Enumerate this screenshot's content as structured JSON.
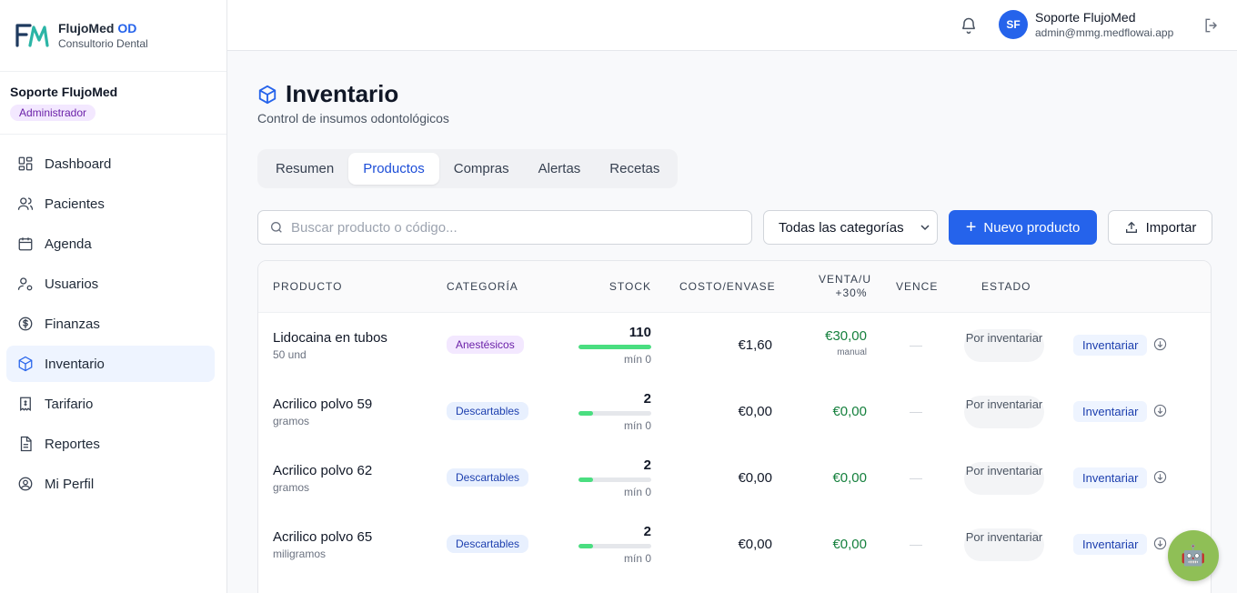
{
  "brand": {
    "name": "FlujoMed",
    "accent": "OD",
    "subtitle": "Consultorio Dental"
  },
  "user": {
    "name": "Soporte FlujoMed",
    "role": "Administrador",
    "initials": "SF",
    "email": "admin@mmg.medflowai.app"
  },
  "nav": [
    {
      "label": "Dashboard",
      "icon": "dashboard-icon"
    },
    {
      "label": "Pacientes",
      "icon": "users-icon"
    },
    {
      "label": "Agenda",
      "icon": "calendar-icon"
    },
    {
      "label": "Usuarios",
      "icon": "user-cog-icon"
    },
    {
      "label": "Finanzas",
      "icon": "dollar-circle-icon"
    },
    {
      "label": "Inventario",
      "icon": "box-icon",
      "active": true
    },
    {
      "label": "Tarifario",
      "icon": "receipt-icon"
    },
    {
      "label": "Reportes",
      "icon": "document-icon"
    },
    {
      "label": "Mi Perfil",
      "icon": "user-circle-icon"
    }
  ],
  "page": {
    "title": "Inventario",
    "subtitle": "Control de insumos odontológicos"
  },
  "tabs": [
    {
      "label": "Resumen"
    },
    {
      "label": "Productos",
      "active": true
    },
    {
      "label": "Compras"
    },
    {
      "label": "Alertas"
    },
    {
      "label": "Recetas"
    }
  ],
  "toolbar": {
    "search_placeholder": "Buscar producto o código...",
    "category_selected": "Todas las categorías",
    "new_product_label": "Nuevo producto",
    "import_label": "Importar"
  },
  "table": {
    "headers": {
      "producto": "PRODUCTO",
      "categoria": "CATEGORÍA",
      "stock": "STOCK",
      "costo": "COSTO/ENVASE",
      "venta_1": "VENTA/U",
      "venta_2": "+30%",
      "vence": "VENCE",
      "estado": "ESTADO"
    },
    "rows": [
      {
        "name": "Lidocaina en tubos",
        "unit": "50 und",
        "category": "Anestésicos",
        "category_color": "purple",
        "stock": "110",
        "stock_level": 1.0,
        "min": "mín 0",
        "cost": "€1,60",
        "sale": "€30,00",
        "sale_note": "manual",
        "vence": "—",
        "estado": "Por inventariar",
        "action": "Inventariar"
      },
      {
        "name": "Acrilico polvo 59",
        "unit": "gramos",
        "category": "Descartables",
        "category_color": "blue",
        "stock": "2",
        "stock_level": 0.2,
        "min": "mín 0",
        "cost": "€0,00",
        "sale": "€0,00",
        "sale_note": "",
        "vence": "—",
        "estado": "Por inventariar",
        "action": "Inventariar"
      },
      {
        "name": "Acrilico polvo 62",
        "unit": "gramos",
        "category": "Descartables",
        "category_color": "blue",
        "stock": "2",
        "stock_level": 0.2,
        "min": "mín 0",
        "cost": "€0,00",
        "sale": "€0,00",
        "sale_note": "",
        "vence": "—",
        "estado": "Por inventariar",
        "action": "Inventariar"
      },
      {
        "name": "Acrilico polvo 65",
        "unit": "miligramos",
        "category": "Descartables",
        "category_color": "blue",
        "stock": "2",
        "stock_level": 0.2,
        "min": "mín 0",
        "cost": "€0,00",
        "sale": "€0,00",
        "sale_note": "",
        "vence": "—",
        "estado": "Por inventariar",
        "action": "Inventariar"
      }
    ]
  },
  "colors": {
    "primary": "#2563eb",
    "sale_green": "#15803d",
    "stock_green": "#4ade80",
    "fab": "#8fbf56"
  },
  "fab": {
    "icon": "robot-icon"
  }
}
